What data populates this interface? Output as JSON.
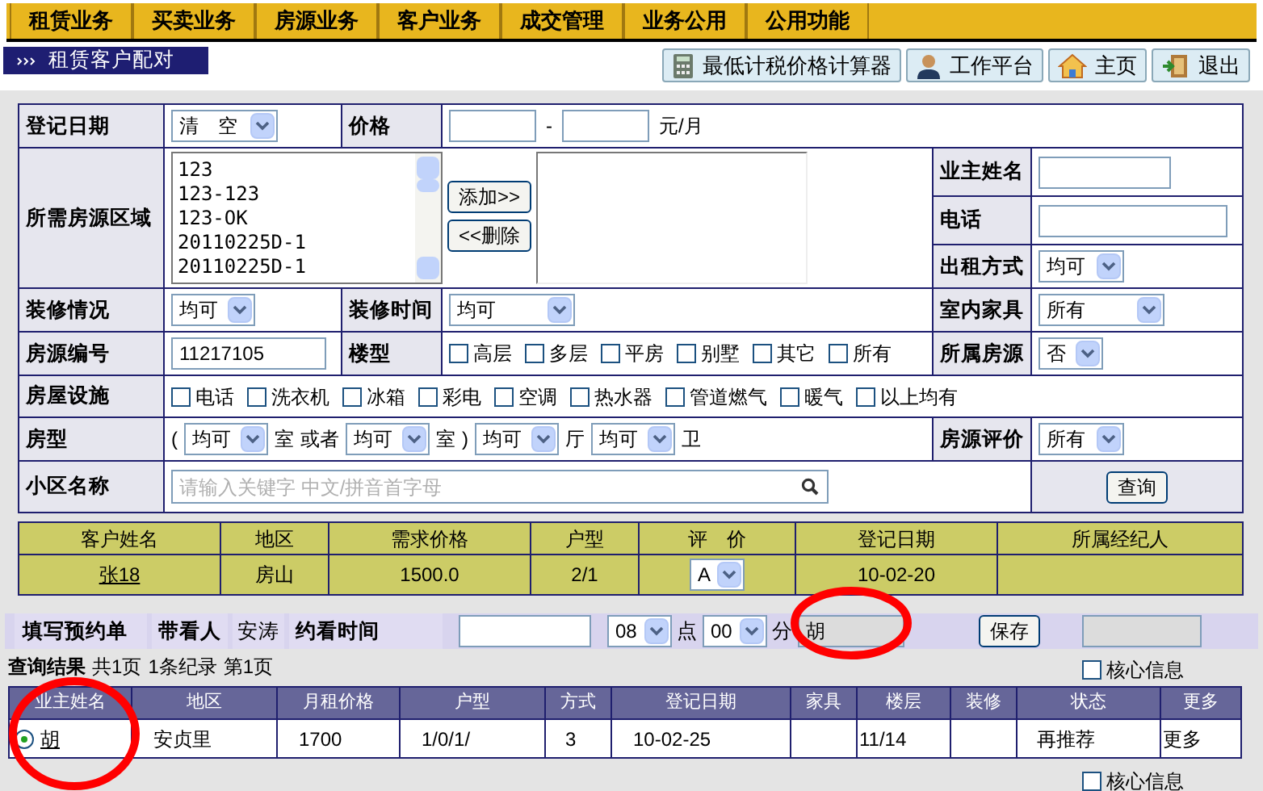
{
  "menu": [
    "租赁业务",
    "买卖业务",
    "房源业务",
    "客户业务",
    "成交管理",
    "业务公用",
    "公用功能"
  ],
  "page_title": "租赁客户配对",
  "toolbar_buttons": [
    {
      "kind": "calculator",
      "label": "最低计税价格计算器"
    },
    {
      "kind": "user",
      "label": "工作平台"
    },
    {
      "kind": "home",
      "label": "主页"
    },
    {
      "kind": "exit",
      "label": "退出"
    }
  ],
  "form": {
    "reg_date": {
      "label": "登记日期",
      "value": "清　空"
    },
    "price": {
      "label": "价格",
      "separator": "-",
      "unit": "元/月"
    },
    "area": {
      "label": "所需房源区域",
      "options": [
        "123",
        "123-123",
        "123-OK",
        "20110225D-1",
        "20110225D-1"
      ],
      "add": "添加>>",
      "remove": "<<删除"
    },
    "owner": {
      "label": "业主姓名"
    },
    "phone": {
      "label": "电话"
    },
    "rent_mode": {
      "label": "出租方式",
      "value": "均可"
    },
    "decoration": {
      "label": "装修情况",
      "value": "均可"
    },
    "decoration_time": {
      "label": "装修时间",
      "value": "均可"
    },
    "furniture": {
      "label": "室内家具",
      "value": "所有"
    },
    "source_no": {
      "label": "房源编号",
      "value": "11217105"
    },
    "building_type": {
      "label": "楼型",
      "options": [
        {
          "label": "高层",
          "checked": false
        },
        {
          "label": "多层",
          "checked": false
        },
        {
          "label": "平房",
          "checked": false
        },
        {
          "label": "别墅",
          "checked": false
        },
        {
          "label": "其它",
          "checked": false
        },
        {
          "label": "所有",
          "checked": false
        }
      ]
    },
    "owned_source": {
      "label": "所属房源",
      "value": "否"
    },
    "facilities": {
      "label": "房屋设施",
      "options": [
        {
          "label": "电话",
          "checked": false
        },
        {
          "label": "洗衣机",
          "checked": false
        },
        {
          "label": "冰箱",
          "checked": false
        },
        {
          "label": "彩电",
          "checked": false
        },
        {
          "label": "空调",
          "checked": false
        },
        {
          "label": "热水器",
          "checked": false
        },
        {
          "label": "管道燃气",
          "checked": false
        },
        {
          "label": "暖气",
          "checked": false
        },
        {
          "label": "以上均有",
          "checked": false
        }
      ]
    },
    "room_type": {
      "label": "房型",
      "parts": [
        {
          "kind": "text",
          "text": "("
        },
        {
          "kind": "select",
          "value": "均可"
        },
        {
          "kind": "text",
          "text": "室"
        },
        {
          "kind": "text",
          "text": "或者"
        },
        {
          "kind": "select",
          "value": "均可"
        },
        {
          "kind": "text",
          "text": "室"
        },
        {
          "kind": "text",
          "text": ")"
        },
        {
          "kind": "select",
          "value": "均可"
        },
        {
          "kind": "text",
          "text": "厅"
        },
        {
          "kind": "select",
          "value": "均可"
        },
        {
          "kind": "text",
          "text": "卫"
        }
      ]
    },
    "rating": {
      "label": "房源评价",
      "value": "所有"
    },
    "community": {
      "label": "小区名称",
      "placeholder": "请输入关键字 中文/拼音首字母"
    },
    "query": "查询"
  },
  "customer_table": {
    "columns": [
      "客户姓名",
      "地区",
      "需求价格",
      "户型",
      "评　价",
      "登记日期",
      "所属经纪人"
    ],
    "row": [
      {
        "kind": "link",
        "text": "张18"
      },
      {
        "kind": "text",
        "text": "房山"
      },
      {
        "kind": "text",
        "text": "1500.0"
      },
      {
        "kind": "text",
        "text": "2/1"
      },
      {
        "kind": "select",
        "text": "A"
      },
      {
        "kind": "text",
        "text": "10-02-20"
      },
      {
        "kind": "empty"
      }
    ]
  },
  "appointment": {
    "title": "填写预约单",
    "viewer_label": "带看人",
    "viewer": "安涛",
    "time_label": "约看时间",
    "hour": "08",
    "hour_unit": "点",
    "minute": "00",
    "minute_unit": "分",
    "name": "胡",
    "save": "保存"
  },
  "results": {
    "title": "查询结果",
    "pages": "共1页",
    "records": "1条纪录",
    "page": "第1页",
    "core_info": {
      "label": "核心信息",
      "checked": false
    },
    "columns": [
      "业主姓名",
      "地区",
      "月租价格",
      "户型",
      "方式",
      "登记日期",
      "家具",
      "楼层",
      "装修",
      "状态",
      "更多"
    ],
    "rows": [
      {
        "selected": true,
        "cells": [
          "胡",
          "安贞里",
          "1700",
          "1/0/1/",
          "3",
          "10-02-25",
          null,
          "11/14",
          null,
          "再推荐",
          "更多"
        ]
      }
    ],
    "core_info_bottom": {
      "label": "核心信息",
      "checked": false
    }
  },
  "annotations": [
    {
      "kind": "ellipse",
      "color": "#ff0000"
    },
    {
      "kind": "ellipse",
      "color": "#ff0000"
    }
  ]
}
